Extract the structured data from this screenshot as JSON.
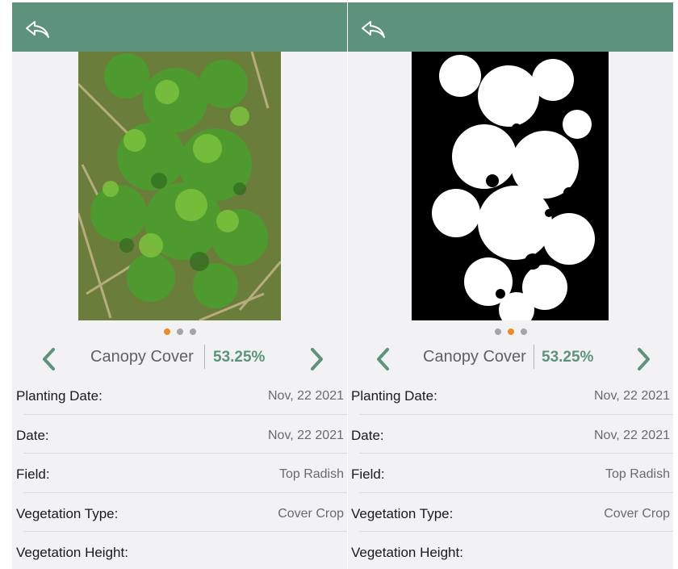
{
  "colors": {
    "header": "#5c937a",
    "panel_bg": "#f2f2f4",
    "accent_value": "#5c937a",
    "dot_active": "#f08a2a",
    "dot_inactive": "#a5a5a8"
  },
  "icons": {
    "back": "back-arrow-icon",
    "prev": "chevron-left-icon",
    "next": "chevron-right-icon"
  },
  "left_panel": {
    "image": "canopy-photo",
    "dots": {
      "count": 3,
      "active_index": 0
    },
    "metric": {
      "label": "Canopy Cover",
      "value": "53.25%"
    },
    "details": [
      {
        "label": "Planting Date:",
        "value": "Nov, 22 2021"
      },
      {
        "label": "Date:",
        "value": "Nov, 22 2021"
      },
      {
        "label": "Field:",
        "value": "Top Radish"
      },
      {
        "label": "Vegetation Type:",
        "value": "Cover Crop"
      },
      {
        "label": "Vegetation Height:",
        "value": ""
      }
    ]
  },
  "right_panel": {
    "image": "canopy-mask",
    "dots": {
      "count": 3,
      "active_index": 1
    },
    "metric": {
      "label": "Canopy Cover",
      "value": "53.25%"
    },
    "details": [
      {
        "label": "Planting Date:",
        "value": "Nov, 22 2021"
      },
      {
        "label": "Date:",
        "value": "Nov, 22 2021"
      },
      {
        "label": "Field:",
        "value": "Top Radish"
      },
      {
        "label": "Vegetation Type:",
        "value": "Cover Crop"
      },
      {
        "label": "Vegetation Height:",
        "value": ""
      }
    ]
  }
}
